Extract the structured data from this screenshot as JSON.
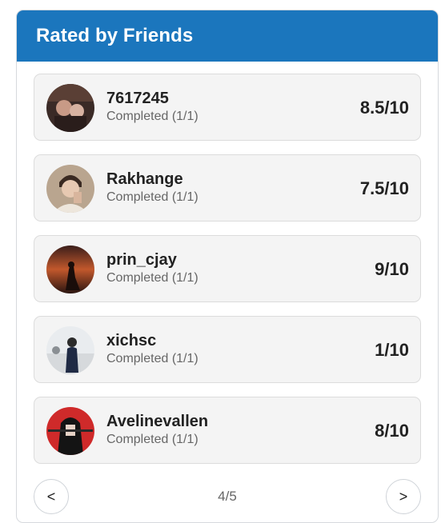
{
  "panel": {
    "title": "Rated by Friends"
  },
  "ratings": [
    {
      "name": "7617245",
      "status": "Completed (1/1)",
      "score": "8.5/10"
    },
    {
      "name": "Rakhange",
      "status": "Completed (1/1)",
      "score": "7.5/10"
    },
    {
      "name": "prin_cjay",
      "status": "Completed (1/1)",
      "score": "9/10"
    },
    {
      "name": "xichsc",
      "status": "Completed (1/1)",
      "score": "1/10"
    },
    {
      "name": "Avelinevallen",
      "status": "Completed (1/1)",
      "score": "8/10"
    }
  ],
  "pagination": {
    "prev_label": "<",
    "next_label": ">",
    "indicator": "4/5"
  },
  "colors": {
    "header": "#1b76bd",
    "card_bg": "#f4f4f4"
  }
}
